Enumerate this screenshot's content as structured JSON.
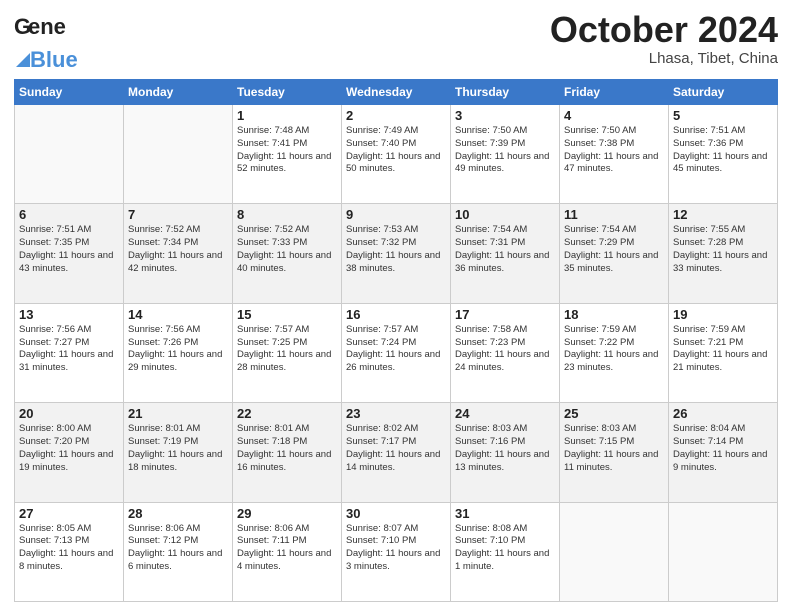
{
  "header": {
    "logo_line1": "General",
    "logo_line2": "Blue",
    "month": "October 2024",
    "location": "Lhasa, Tibet, China"
  },
  "weekdays": [
    "Sunday",
    "Monday",
    "Tuesday",
    "Wednesday",
    "Thursday",
    "Friday",
    "Saturday"
  ],
  "weeks": [
    [
      {
        "day": "",
        "sunrise": "",
        "sunset": "",
        "daylight": ""
      },
      {
        "day": "",
        "sunrise": "",
        "sunset": "",
        "daylight": ""
      },
      {
        "day": "1",
        "sunrise": "Sunrise: 7:48 AM",
        "sunset": "Sunset: 7:41 PM",
        "daylight": "Daylight: 11 hours and 52 minutes."
      },
      {
        "day": "2",
        "sunrise": "Sunrise: 7:49 AM",
        "sunset": "Sunset: 7:40 PM",
        "daylight": "Daylight: 11 hours and 50 minutes."
      },
      {
        "day": "3",
        "sunrise": "Sunrise: 7:50 AM",
        "sunset": "Sunset: 7:39 PM",
        "daylight": "Daylight: 11 hours and 49 minutes."
      },
      {
        "day": "4",
        "sunrise": "Sunrise: 7:50 AM",
        "sunset": "Sunset: 7:38 PM",
        "daylight": "Daylight: 11 hours and 47 minutes."
      },
      {
        "day": "5",
        "sunrise": "Sunrise: 7:51 AM",
        "sunset": "Sunset: 7:36 PM",
        "daylight": "Daylight: 11 hours and 45 minutes."
      }
    ],
    [
      {
        "day": "6",
        "sunrise": "Sunrise: 7:51 AM",
        "sunset": "Sunset: 7:35 PM",
        "daylight": "Daylight: 11 hours and 43 minutes."
      },
      {
        "day": "7",
        "sunrise": "Sunrise: 7:52 AM",
        "sunset": "Sunset: 7:34 PM",
        "daylight": "Daylight: 11 hours and 42 minutes."
      },
      {
        "day": "8",
        "sunrise": "Sunrise: 7:52 AM",
        "sunset": "Sunset: 7:33 PM",
        "daylight": "Daylight: 11 hours and 40 minutes."
      },
      {
        "day": "9",
        "sunrise": "Sunrise: 7:53 AM",
        "sunset": "Sunset: 7:32 PM",
        "daylight": "Daylight: 11 hours and 38 minutes."
      },
      {
        "day": "10",
        "sunrise": "Sunrise: 7:54 AM",
        "sunset": "Sunset: 7:31 PM",
        "daylight": "Daylight: 11 hours and 36 minutes."
      },
      {
        "day": "11",
        "sunrise": "Sunrise: 7:54 AM",
        "sunset": "Sunset: 7:29 PM",
        "daylight": "Daylight: 11 hours and 35 minutes."
      },
      {
        "day": "12",
        "sunrise": "Sunrise: 7:55 AM",
        "sunset": "Sunset: 7:28 PM",
        "daylight": "Daylight: 11 hours and 33 minutes."
      }
    ],
    [
      {
        "day": "13",
        "sunrise": "Sunrise: 7:56 AM",
        "sunset": "Sunset: 7:27 PM",
        "daylight": "Daylight: 11 hours and 31 minutes."
      },
      {
        "day": "14",
        "sunrise": "Sunrise: 7:56 AM",
        "sunset": "Sunset: 7:26 PM",
        "daylight": "Daylight: 11 hours and 29 minutes."
      },
      {
        "day": "15",
        "sunrise": "Sunrise: 7:57 AM",
        "sunset": "Sunset: 7:25 PM",
        "daylight": "Daylight: 11 hours and 28 minutes."
      },
      {
        "day": "16",
        "sunrise": "Sunrise: 7:57 AM",
        "sunset": "Sunset: 7:24 PM",
        "daylight": "Daylight: 11 hours and 26 minutes."
      },
      {
        "day": "17",
        "sunrise": "Sunrise: 7:58 AM",
        "sunset": "Sunset: 7:23 PM",
        "daylight": "Daylight: 11 hours and 24 minutes."
      },
      {
        "day": "18",
        "sunrise": "Sunrise: 7:59 AM",
        "sunset": "Sunset: 7:22 PM",
        "daylight": "Daylight: 11 hours and 23 minutes."
      },
      {
        "day": "19",
        "sunrise": "Sunrise: 7:59 AM",
        "sunset": "Sunset: 7:21 PM",
        "daylight": "Daylight: 11 hours and 21 minutes."
      }
    ],
    [
      {
        "day": "20",
        "sunrise": "Sunrise: 8:00 AM",
        "sunset": "Sunset: 7:20 PM",
        "daylight": "Daylight: 11 hours and 19 minutes."
      },
      {
        "day": "21",
        "sunrise": "Sunrise: 8:01 AM",
        "sunset": "Sunset: 7:19 PM",
        "daylight": "Daylight: 11 hours and 18 minutes."
      },
      {
        "day": "22",
        "sunrise": "Sunrise: 8:01 AM",
        "sunset": "Sunset: 7:18 PM",
        "daylight": "Daylight: 11 hours and 16 minutes."
      },
      {
        "day": "23",
        "sunrise": "Sunrise: 8:02 AM",
        "sunset": "Sunset: 7:17 PM",
        "daylight": "Daylight: 11 hours and 14 minutes."
      },
      {
        "day": "24",
        "sunrise": "Sunrise: 8:03 AM",
        "sunset": "Sunset: 7:16 PM",
        "daylight": "Daylight: 11 hours and 13 minutes."
      },
      {
        "day": "25",
        "sunrise": "Sunrise: 8:03 AM",
        "sunset": "Sunset: 7:15 PM",
        "daylight": "Daylight: 11 hours and 11 minutes."
      },
      {
        "day": "26",
        "sunrise": "Sunrise: 8:04 AM",
        "sunset": "Sunset: 7:14 PM",
        "daylight": "Daylight: 11 hours and 9 minutes."
      }
    ],
    [
      {
        "day": "27",
        "sunrise": "Sunrise: 8:05 AM",
        "sunset": "Sunset: 7:13 PM",
        "daylight": "Daylight: 11 hours and 8 minutes."
      },
      {
        "day": "28",
        "sunrise": "Sunrise: 8:06 AM",
        "sunset": "Sunset: 7:12 PM",
        "daylight": "Daylight: 11 hours and 6 minutes."
      },
      {
        "day": "29",
        "sunrise": "Sunrise: 8:06 AM",
        "sunset": "Sunset: 7:11 PM",
        "daylight": "Daylight: 11 hours and 4 minutes."
      },
      {
        "day": "30",
        "sunrise": "Sunrise: 8:07 AM",
        "sunset": "Sunset: 7:10 PM",
        "daylight": "Daylight: 11 hours and 3 minutes."
      },
      {
        "day": "31",
        "sunrise": "Sunrise: 8:08 AM",
        "sunset": "Sunset: 7:10 PM",
        "daylight": "Daylight: 11 hours and 1 minute."
      },
      {
        "day": "",
        "sunrise": "",
        "sunset": "",
        "daylight": ""
      },
      {
        "day": "",
        "sunrise": "",
        "sunset": "",
        "daylight": ""
      }
    ]
  ]
}
